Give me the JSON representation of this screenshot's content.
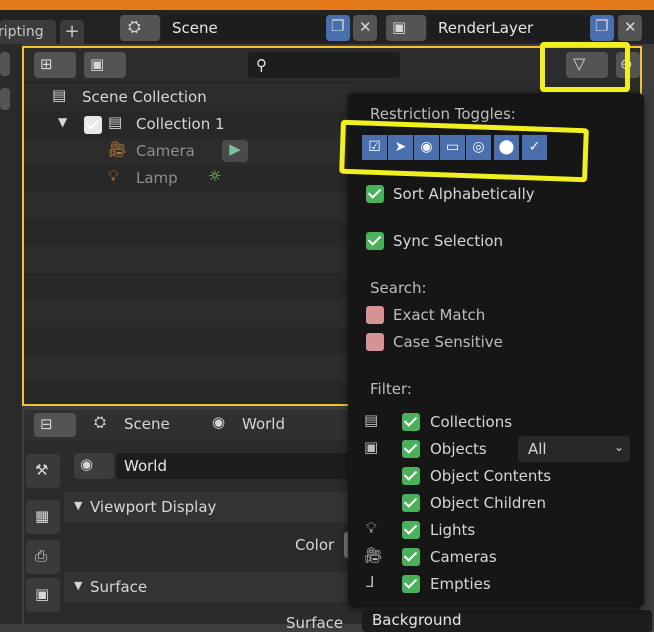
{
  "topbar": {
    "workspace_tab": "ripting",
    "add_tab": "+",
    "scene_label": "Scene",
    "render_layer_label": "RenderLayer"
  },
  "outliner": {
    "scene_collection": "Scene Collection",
    "collection": "Collection 1",
    "camera": "Camera",
    "lamp": "Lamp"
  },
  "filter_popup": {
    "restriction_title": "Restriction Toggles:",
    "sort_alphabetically": "Sort Alphabetically",
    "sync_selection": "Sync Selection",
    "search_title": "Search:",
    "exact_match": "Exact Match",
    "case_sensitive": "Case Sensitive",
    "filter_title": "Filter:",
    "filters": [
      "Collections",
      "Objects",
      "Object Contents",
      "Object Children",
      "Lights",
      "Cameras",
      "Empties"
    ],
    "objects_dropdown": "All",
    "checked": {
      "sort_alphabetically": true,
      "sync_selection": true,
      "exact_match": false,
      "case_sensitive": false
    }
  },
  "properties": {
    "breadcrumb_scene": "Scene",
    "breadcrumb_world": "World",
    "world_field": "World",
    "viewport_display": "Viewport Display",
    "color_label": "Color",
    "surface_section": "Surface",
    "surface_label": "Surface",
    "surface_value": "Background"
  },
  "colors": {
    "accent_orange": "#e57a1a",
    "highlight_yellow": "#f0f020",
    "check_green": "#4bb05c",
    "toggle_blue": "#4a6fae"
  }
}
